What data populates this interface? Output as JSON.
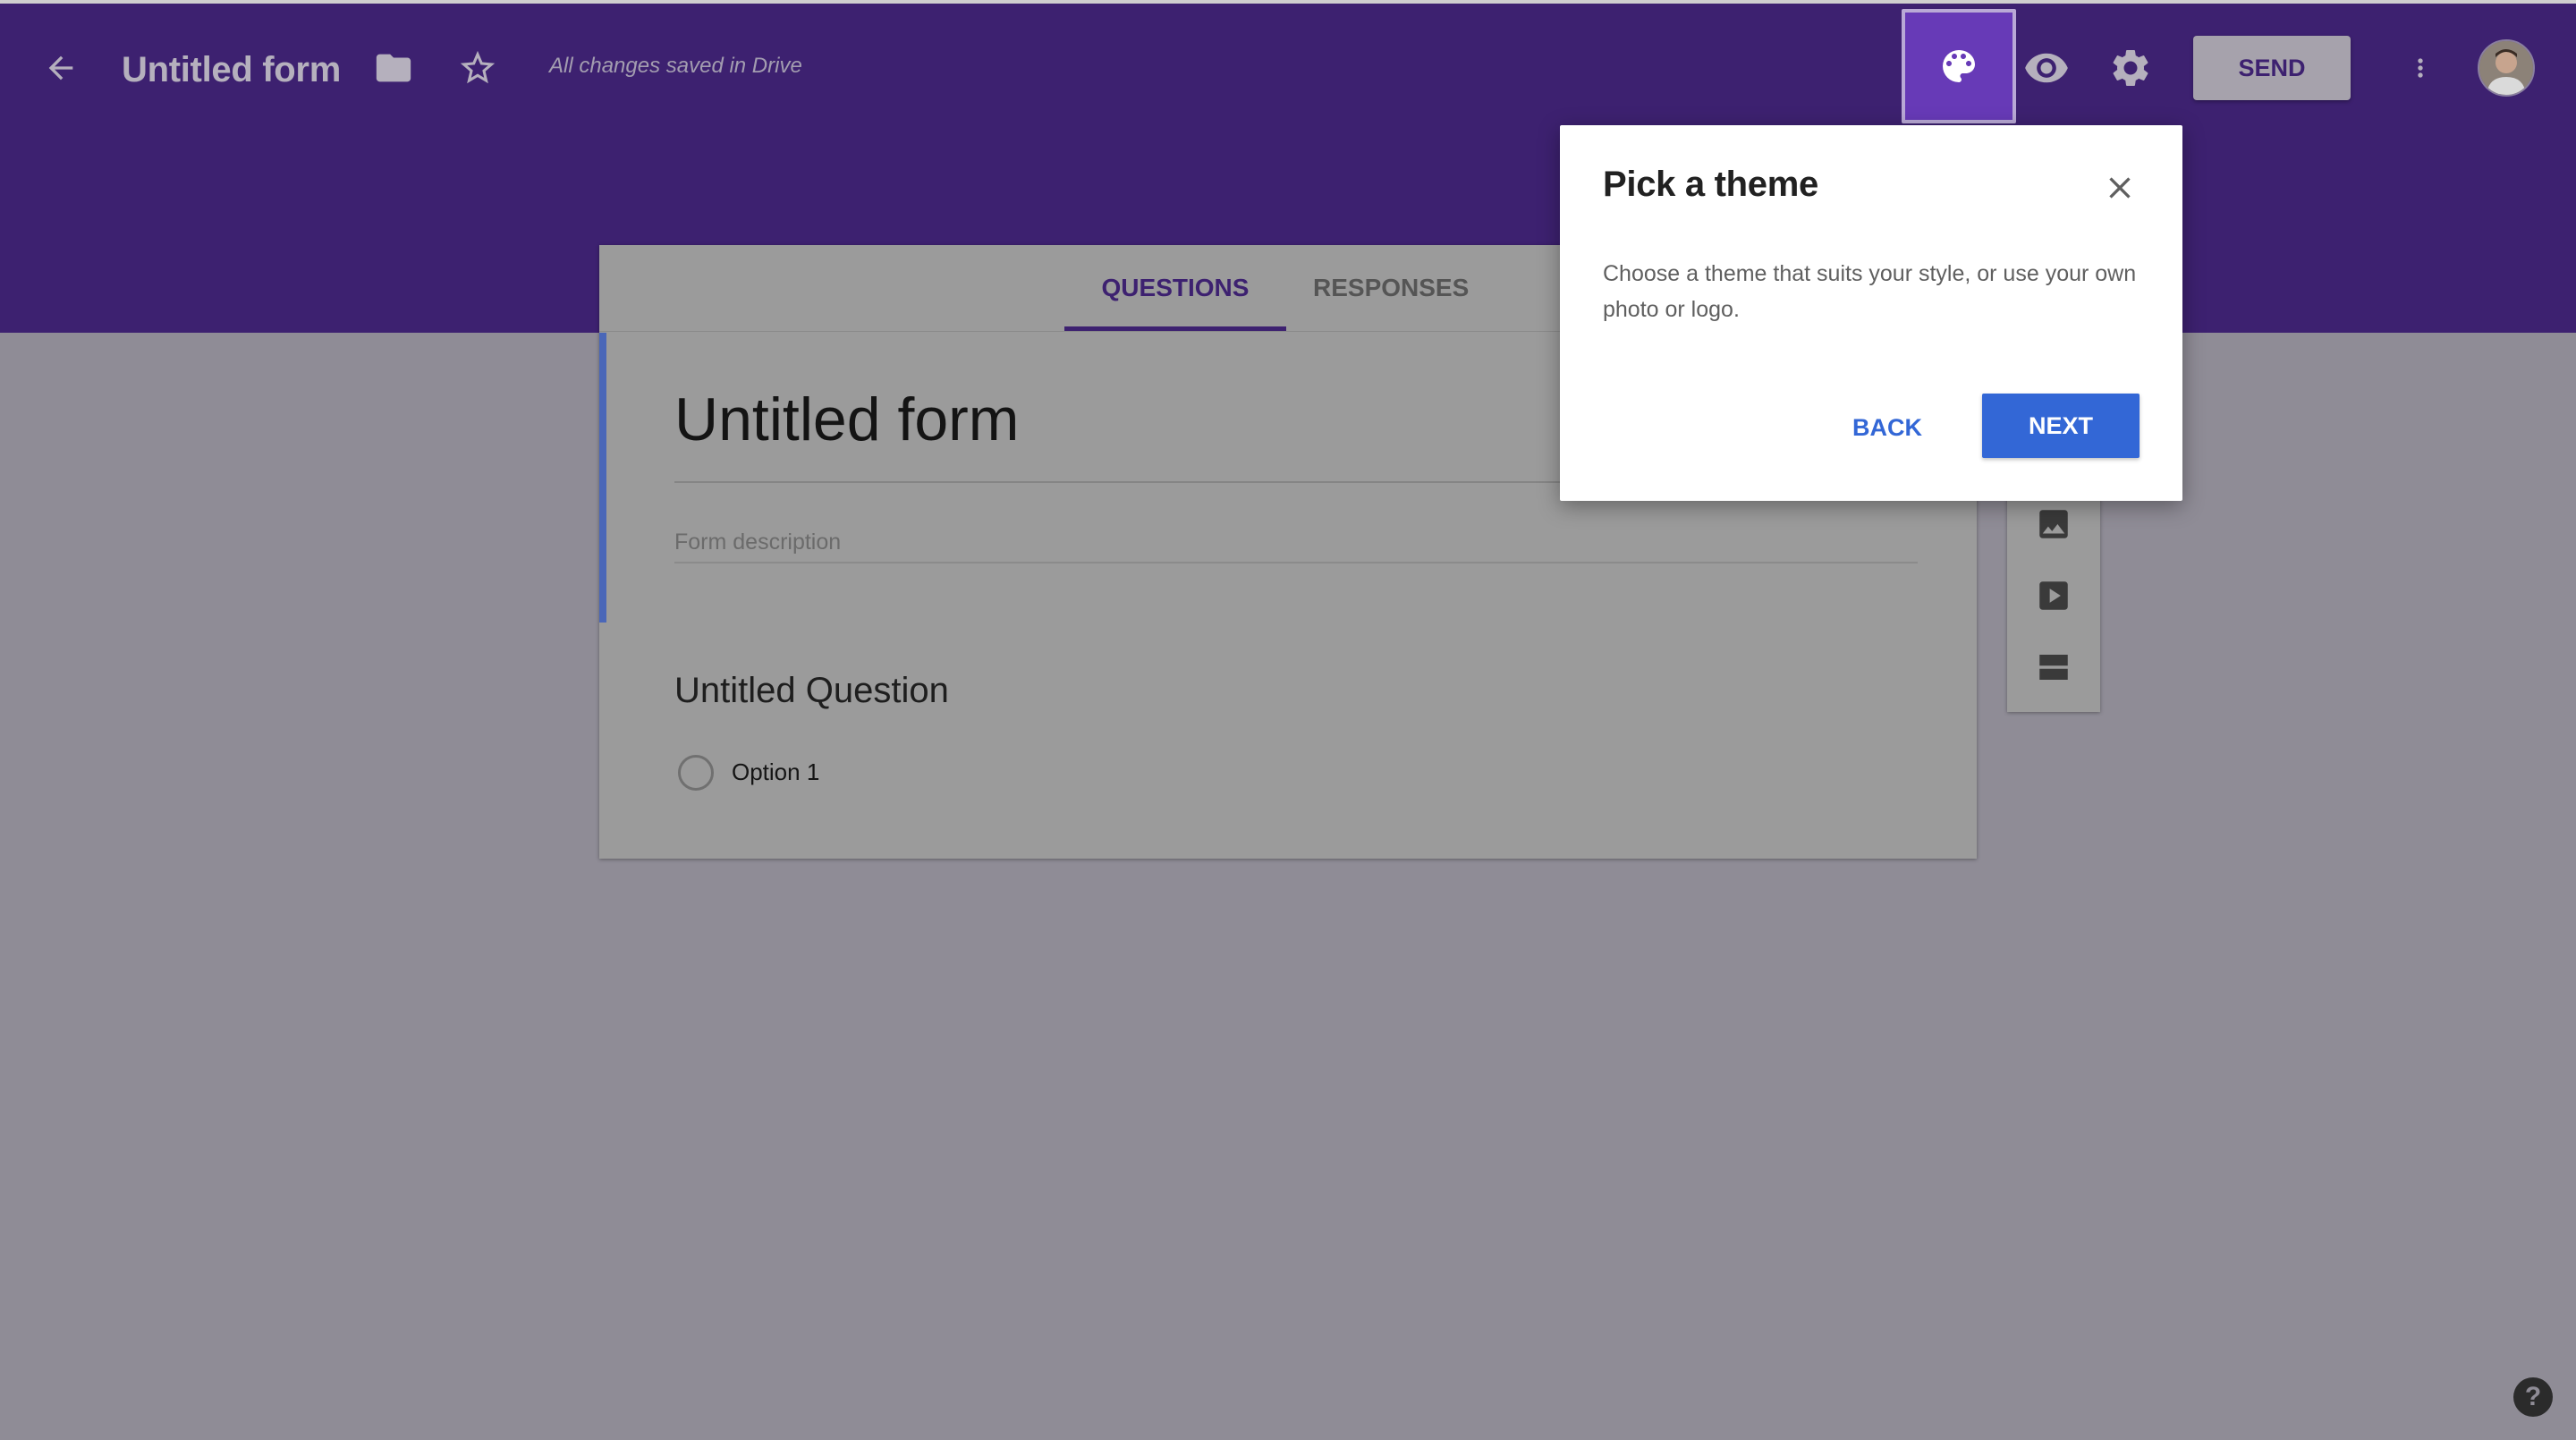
{
  "header": {
    "title": "Untitled form",
    "save_status": "All changes saved in Drive",
    "send_label": "SEND",
    "icons": [
      "arrow-back-icon",
      "folder-icon",
      "star-outline-icon",
      "palette-icon",
      "eye-icon",
      "gear-icon",
      "more-vert-icon"
    ]
  },
  "tabs": [
    {
      "label": "QUESTIONS",
      "active": true
    },
    {
      "label": "RESPONSES",
      "active": false
    }
  ],
  "form": {
    "title": "Untitled form",
    "description_placeholder": "Form description",
    "question": {
      "title": "Untitled Question",
      "options": [
        "Option 1"
      ]
    }
  },
  "side_toolbar": {
    "icons": [
      "image-icon",
      "video-icon",
      "section-icon"
    ]
  },
  "dialog": {
    "title": "Pick a theme",
    "body": "Choose a theme that suits your style, or use your own photo or logo.",
    "back_label": "BACK",
    "next_label": "NEXT"
  },
  "help": {
    "label": "?"
  },
  "colors": {
    "header": "#3d2170",
    "accent": "#673ab7",
    "primary_button": "#3367d6",
    "title_bar": "#4a67b8",
    "overlay_bg": "#8f8c96"
  }
}
